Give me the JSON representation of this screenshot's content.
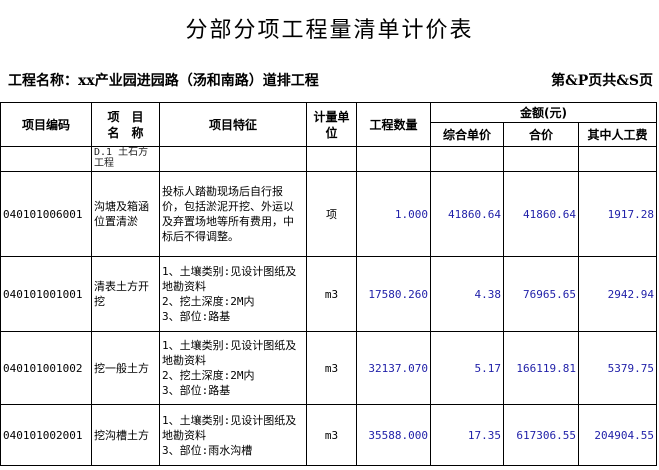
{
  "title": "分部分项工程量清单计价表",
  "project_label": "工程名称：xx产业园进园路（汤和南路）道排工程",
  "page_info": "第&P页共&S页",
  "headers": {
    "code": "项目编码",
    "name": "项　目\n名　称",
    "features": "项目特征",
    "unit": "计量单位",
    "qty": "工程数量",
    "amount": "金额(元)",
    "unit_price": "综合单价",
    "total": "合价",
    "labor": "其中人工费"
  },
  "section": {
    "name": "D.1 土石方工程"
  },
  "rows": [
    {
      "code": "040101006001",
      "name": "沟塘及箱涵位置清淤",
      "features": "投标人踏勘现场后自行报价，包括淤泥开挖、外运以及弃置场地等所有费用，中标后不得调整。",
      "unit": "项",
      "qty": "1.000",
      "unit_price": "41860.64",
      "total": "41860.64",
      "labor": "1917.28"
    },
    {
      "code": "040101001001",
      "name": "清表土方开挖",
      "features": "1、土壤类别:见设计图纸及地勘资料\n2、挖土深度:2M内\n3、部位:路基",
      "unit": "m3",
      "qty": "17580.260",
      "unit_price": "4.38",
      "total": "76965.65",
      "labor": "2942.94"
    },
    {
      "code": "040101001002",
      "name": "挖一般土方",
      "features": "1、土壤类别:见设计图纸及地勘资料\n2、挖土深度:2M内\n3、部位:路基",
      "unit": "m3",
      "qty": "32137.070",
      "unit_price": "5.17",
      "total": "166119.81",
      "labor": "5379.75"
    },
    {
      "code": "040101002001",
      "name": "挖沟槽土方",
      "features": "1、土壤类别:见设计图纸及地勘资料\n3、部位:雨水沟槽",
      "unit": "m3",
      "qty": "35588.000",
      "unit_price": "17.35",
      "total": "617306.55",
      "labor": "204904.55"
    }
  ]
}
